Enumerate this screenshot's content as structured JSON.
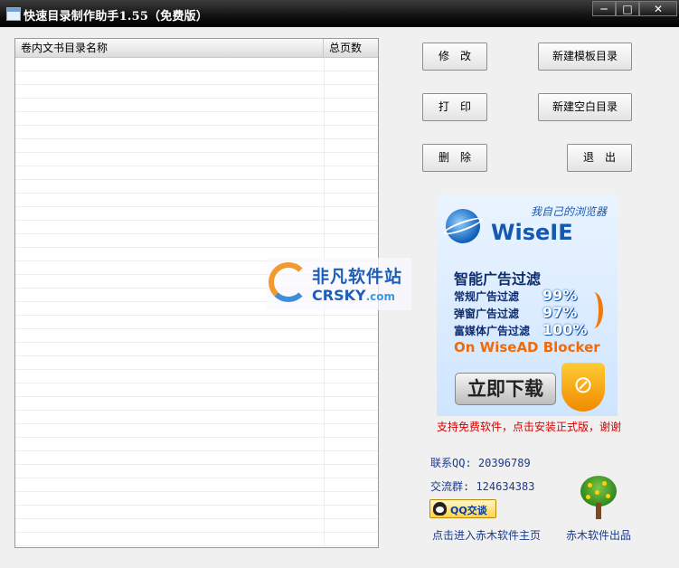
{
  "window": {
    "title": "快速目录制作助手1.55（免费版）",
    "controls": {
      "minimize": "─",
      "maximize": "□",
      "close": "✕"
    }
  },
  "list": {
    "columns": [
      "卷内文书目录名称",
      "总页数"
    ],
    "rows": []
  },
  "buttons": {
    "modify": "修　改",
    "print": "打　印",
    "delete": "删　除",
    "new_template": "新建模板目录",
    "new_blank": "新建空白目录",
    "exit": "退　出"
  },
  "watermark": {
    "cn": "非凡软件站",
    "en_main": "CRSKY",
    "en_suffix": ".com"
  },
  "ad": {
    "brand": "WiseIE",
    "slogan": "我自己的浏览器",
    "headline": "智能广告过滤",
    "rows": [
      {
        "label": "常规广告过滤",
        "pct": "99%"
      },
      {
        "label": "弹窗广告过滤",
        "pct": "97%"
      },
      {
        "label": "富媒体广告过滤",
        "pct": "100%"
      }
    ],
    "tagline_en": "On WiseAD Blocker",
    "download": "立即下载"
  },
  "support_text": "支持免费软件，点击安装正式版，谢谢",
  "contact": {
    "qq": "联系QQ: 20396789",
    "group": "交流群: 124634383",
    "qq_button": "QQ交谈"
  },
  "links": {
    "homepage": "点击进入赤木软件主页",
    "publisher": "赤木软件出品"
  },
  "colors": {
    "titlebar": "#000000",
    "support_text": "#d40000",
    "link_text": "#1b3a8c"
  }
}
